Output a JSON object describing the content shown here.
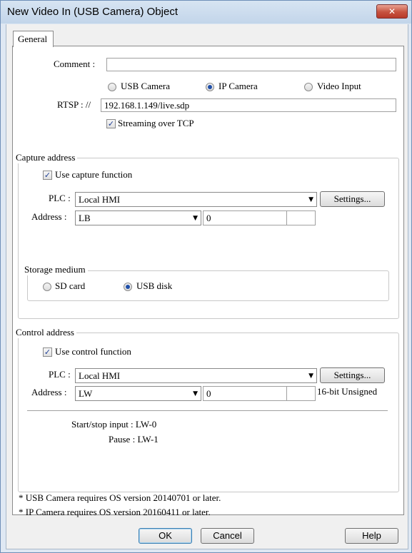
{
  "window": {
    "title": "New Video In (USB Camera) Object",
    "close_glyph": "✕"
  },
  "tabs": [
    {
      "label": "General"
    }
  ],
  "general": {
    "comment_label": "Comment :",
    "comment_value": "",
    "source_options": [
      {
        "label": "USB Camera",
        "selected": false
      },
      {
        "label": "IP Camera",
        "selected": true
      },
      {
        "label": "Video Input",
        "selected": false
      }
    ],
    "rtsp_label": "RTSP : //",
    "rtsp_value": "192.168.1.149/live.sdp",
    "streaming_tcp_label": "Streaming over TCP",
    "streaming_tcp_checked": true
  },
  "capture": {
    "group_title": "Capture address",
    "use_label": "Use capture function",
    "use_checked": true,
    "plc_label": "PLC :",
    "plc_value": "Local HMI",
    "settings_label": "Settings...",
    "address_label": "Address :",
    "address_device": "LB",
    "address_value": "0",
    "address_extra": "",
    "storage": {
      "group_title": "Storage medium",
      "options": [
        {
          "label": "SD card",
          "selected": false
        },
        {
          "label": "USB disk",
          "selected": true
        }
      ]
    }
  },
  "control": {
    "group_title": "Control address",
    "use_label": "Use control function",
    "use_checked": true,
    "plc_label": "PLC :",
    "plc_value": "Local HMI",
    "settings_label": "Settings...",
    "address_label": "Address :",
    "address_device": "LW",
    "address_value": "0",
    "address_extra": "",
    "data_format": "16-bit Unsigned",
    "start_stop_text": "Start/stop input : LW-0",
    "pause_text": "Pause : LW-1"
  },
  "notes": [
    "* USB Camera requires OS version 20140701 or later.",
    "* IP Camera requires OS version 20160411 or later."
  ],
  "buttons": {
    "ok": "OK",
    "cancel": "Cancel",
    "help": "Help"
  },
  "colors": {
    "radio_selected": "#1f4fa8",
    "check_mark": "#1f3f96",
    "title_bar": "#c2d5ea"
  }
}
